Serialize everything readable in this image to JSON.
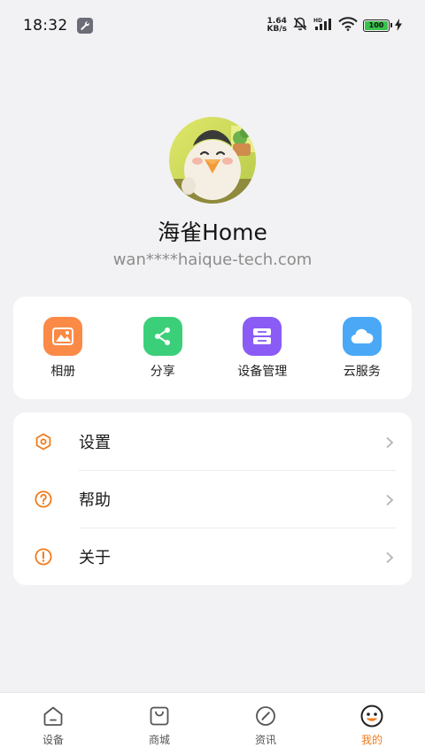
{
  "status_bar": {
    "time": "18:32",
    "net_speed_value": "1.64",
    "net_speed_unit": "KB/s",
    "battery": "100",
    "battery_level": 1.0
  },
  "profile": {
    "name": "海雀Home",
    "email": "wan****haique-tech.com"
  },
  "quick_actions": [
    {
      "label": "相册",
      "icon": "album-icon",
      "color": "#fb8a47"
    },
    {
      "label": "分享",
      "icon": "share-icon",
      "color": "#3ccf7a"
    },
    {
      "label": "设备管理",
      "icon": "device-manage-icon",
      "color": "#8a5cf5"
    },
    {
      "label": "云服务",
      "icon": "cloud-icon",
      "color": "#4aa8f7"
    }
  ],
  "menu": [
    {
      "label": "设置",
      "icon": "settings-icon"
    },
    {
      "label": "帮助",
      "icon": "help-icon"
    },
    {
      "label": "关于",
      "icon": "about-icon"
    }
  ],
  "bottom_nav": [
    {
      "label": "设备",
      "icon": "home-icon",
      "active": false
    },
    {
      "label": "商城",
      "icon": "shop-bag-icon",
      "active": false
    },
    {
      "label": "资讯",
      "icon": "compass-icon",
      "active": false
    },
    {
      "label": "我的",
      "icon": "smiley-face-icon",
      "active": true
    }
  ],
  "colors": {
    "accent": "#f07b1b",
    "background": "#f2f2f4",
    "card": "#ffffff",
    "secondary_text": "#8c8c8c"
  }
}
